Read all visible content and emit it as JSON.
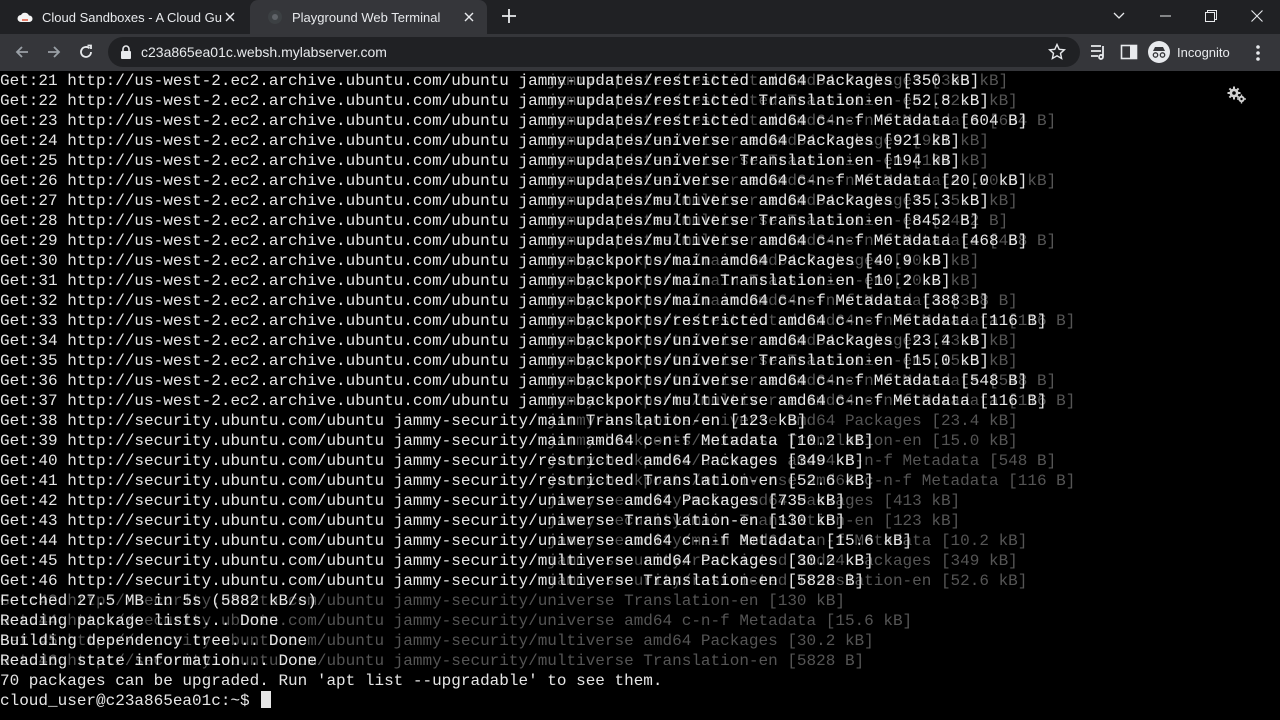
{
  "browser": {
    "tabs": [
      {
        "title": "Cloud Sandboxes - A Cloud Guru",
        "active": false
      },
      {
        "title": "Playground Web Terminal",
        "active": true
      }
    ],
    "url": "c23a865ea01c.websh.mylabserver.com",
    "profile_label": "Incognito"
  },
  "terminal": {
    "lines": [
      "Get:21 http://us-west-2.ec2.archive.ubuntu.com/ubuntu jammy-updates/restricted amd64 Packages [350 kB]",
      "Get:22 http://us-west-2.ec2.archive.ubuntu.com/ubuntu jammy-updates/restricted Translation-en [52.8 kB]",
      "Get:23 http://us-west-2.ec2.archive.ubuntu.com/ubuntu jammy-updates/restricted amd64 c-n-f Metadata [604 B]",
      "Get:24 http://us-west-2.ec2.archive.ubuntu.com/ubuntu jammy-updates/universe amd64 Packages [921 kB]",
      "Get:25 http://us-west-2.ec2.archive.ubuntu.com/ubuntu jammy-updates/universe Translation-en [194 kB]",
      "Get:26 http://us-west-2.ec2.archive.ubuntu.com/ubuntu jammy-updates/universe amd64 c-n-f Metadata [20.0 kB]",
      "Get:27 http://us-west-2.ec2.archive.ubuntu.com/ubuntu jammy-updates/multiverse amd64 Packages [35.3 kB]",
      "Get:28 http://us-west-2.ec2.archive.ubuntu.com/ubuntu jammy-updates/multiverse Translation-en [8452 B]",
      "Get:29 http://us-west-2.ec2.archive.ubuntu.com/ubuntu jammy-updates/multiverse amd64 c-n-f Metadata [468 B]",
      "Get:30 http://us-west-2.ec2.archive.ubuntu.com/ubuntu jammy-backports/main amd64 Packages [40.9 kB]",
      "Get:31 http://us-west-2.ec2.archive.ubuntu.com/ubuntu jammy-backports/main Translation-en [10.2 kB]",
      "Get:32 http://us-west-2.ec2.archive.ubuntu.com/ubuntu jammy-backports/main amd64 c-n-f Metadata [388 B]",
      "Get:33 http://us-west-2.ec2.archive.ubuntu.com/ubuntu jammy-backports/restricted amd64 c-n-f Metadata [116 B]",
      "Get:34 http://us-west-2.ec2.archive.ubuntu.com/ubuntu jammy-backports/universe amd64 Packages [23.4 kB]",
      "Get:35 http://us-west-2.ec2.archive.ubuntu.com/ubuntu jammy-backports/universe Translation-en [15.0 kB]",
      "Get:36 http://us-west-2.ec2.archive.ubuntu.com/ubuntu jammy-backports/universe amd64 c-n-f Metadata [548 B]",
      "Get:37 http://us-west-2.ec2.archive.ubuntu.com/ubuntu jammy-backports/multiverse amd64 c-n-f Metadata [116 B]",
      "Get:38 http://security.ubuntu.com/ubuntu jammy-security/main Translation-en [123 kB]",
      "Get:39 http://security.ubuntu.com/ubuntu jammy-security/main amd64 c-n-f Metadata [10.2 kB]",
      "Get:40 http://security.ubuntu.com/ubuntu jammy-security/restricted amd64 Packages [349 kB]",
      "Get:41 http://security.ubuntu.com/ubuntu jammy-security/restricted Translation-en [52.6 kB]",
      "Get:42 http://security.ubuntu.com/ubuntu jammy-security/universe amd64 Packages [735 kB]",
      "Get:43 http://security.ubuntu.com/ubuntu jammy-security/universe Translation-en [130 kB]",
      "Get:44 http://security.ubuntu.com/ubuntu jammy-security/universe amd64 c-n-f Metadata [15.6 kB]",
      "Get:45 http://security.ubuntu.com/ubuntu jammy-security/multiverse amd64 Packages [30.2 kB]",
      "Get:46 http://security.ubuntu.com/ubuntu jammy-security/multiverse Translation-en [5828 B]",
      "Fetched 27.5 MB in 5s (5882 kB/s)",
      "Reading package lists... Done",
      "Building dependency tree... Done",
      "Reading state information... Done",
      "70 packages can be upgraded. Run 'apt list --upgradable' to see them."
    ],
    "ghost_lines": [
      "                                                         jammy-updates/restricted amd64 Packages [350 kB]",
      "                                                         jammy-updates/restricted Translation-en [52.8 kB]",
      "                                                         jammy-updates/restricted amd64 c-n-f Metadata [604 B]",
      "                                                         jammy-updates/universe amd64 Packages [921 kB]",
      "                                                         jammy-updates/universe Translation-en [194 kB]",
      "                                                         jammy-updates/universe amd64 c-n-f Metadata [20.0 kB]",
      "                                                         jammy-updates/multiverse amd64 Packages [35.3 kB]",
      "                                                         jammy-updates/multiverse Translation-en [8452 B]",
      "                                                         jammy-updates/multiverse amd64 c-n-f Metadata [468 B]",
      "                                                         jammy-backports/main amd64 Packages [40.9 kB]",
      "                                                         jammy-backports/main Translation-en [10.2 kB]",
      "                                                         jammy-backports/main amd64 c-n-f Metadata [388 B]",
      "                                                         jammy-backports/restricted amd64 c-n-f Metadata [116 B]",
      "                                                         jammy-backports/universe amd64 Packages [23.4 kB]",
      "                                                         jammy-backports/universe Translation-en [15.0 kB]",
      "                                                         jammy-backports/universe amd64 c-n-f Metadata [548 B]",
      "                                                         jammy-backports/multiverse amd64 c-n-f Metadata [116 B]",
      "                                                         jammy-backports/universe amd64 Packages [23.4 kB]",
      "                                                         jammy-backports/universe Translation-en [15.0 kB]",
      "                                                         jammy-backports/universe amd64 c-n-f Metadata [548 B]",
      "                                                         jammy-backports/multiverse amd64 c-n-f Metadata [116 B]",
      "                                                         jammy-security/main amd64 Packages [413 kB]",
      "                                                         jammy-security/main Translation-en [123 kB]",
      "                                                         jammy-security/main amd64 c-n-f Metadata [10.2 kB]",
      "                                                         jammy-security/restricted amd64 Packages [349 kB]",
      "                                                         jammy-security/restricted Translation-en [52.6 kB]",
      "Get:43 http://security.ubuntu.com/ubuntu jammy-security/universe Translation-en [130 kB]",
      "Get:44 http://security.ubuntu.com/ubuntu jammy-security/universe amd64 c-n-f Metadata [15.6 kB]",
      "Get:45 http://security.ubuntu.com/ubuntu jammy-security/multiverse amd64 Packages [30.2 kB]",
      "Get:46 http://security.ubuntu.com/ubuntu jammy-security/multiverse Translation-en [5828 B]"
    ],
    "prompt": "cloud_user@c23a865ea01c:~$ "
  }
}
